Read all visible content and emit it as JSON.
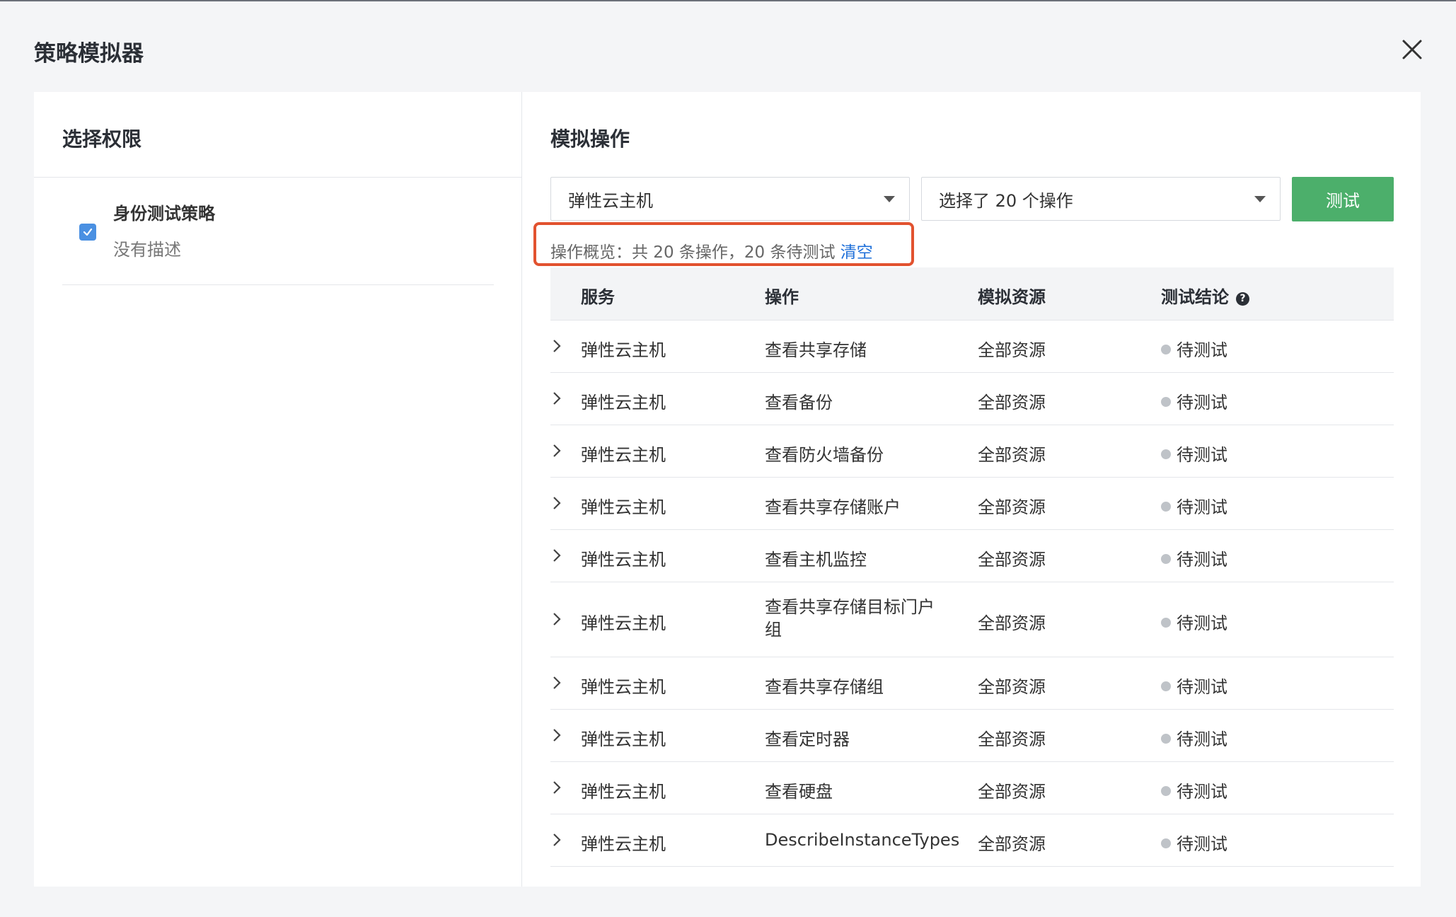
{
  "dialog": {
    "title": "策略模拟器"
  },
  "left_panel": {
    "title": "选择权限",
    "policy": {
      "name": "身份测试策略",
      "description": "没有描述",
      "checked": true
    }
  },
  "right_panel": {
    "title": "模拟操作",
    "service_select": {
      "value": "弹性云主机"
    },
    "action_select": {
      "value": "选择了 20 个操作"
    },
    "test_button": "测试",
    "summary": {
      "text": "操作概览：共 20 条操作，20 条待测试",
      "clear_link": "清空"
    },
    "table": {
      "headers": [
        "服务",
        "操作",
        "模拟资源",
        "测试结论"
      ],
      "rows": [
        {
          "service": "弹性云主机",
          "action": "查看共享存储",
          "resource": "全部资源",
          "status": "待测试"
        },
        {
          "service": "弹性云主机",
          "action": "查看备份",
          "resource": "全部资源",
          "status": "待测试"
        },
        {
          "service": "弹性云主机",
          "action": "查看防火墙备份",
          "resource": "全部资源",
          "status": "待测试"
        },
        {
          "service": "弹性云主机",
          "action": "查看共享存储账户",
          "resource": "全部资源",
          "status": "待测试"
        },
        {
          "service": "弹性云主机",
          "action": "查看主机监控",
          "resource": "全部资源",
          "status": "待测试"
        },
        {
          "service": "弹性云主机",
          "action_line1": "查看共享存储目标门户",
          "action_line2": "组",
          "resource": "全部资源",
          "status": "待测试"
        },
        {
          "service": "弹性云主机",
          "action": "查看共享存储组",
          "resource": "全部资源",
          "status": "待测试"
        },
        {
          "service": "弹性云主机",
          "action": "查看定时器",
          "resource": "全部资源",
          "status": "待测试"
        },
        {
          "service": "弹性云主机",
          "action": "查看硬盘",
          "resource": "全部资源",
          "status": "待测试"
        },
        {
          "service": "弹性云主机",
          "action": "DescribeInstanceTypes",
          "resource": "全部资源",
          "status": "待测试"
        }
      ]
    }
  },
  "colors": {
    "accent_green": "#4caf6b",
    "link_blue": "#1e6fd9",
    "highlight_red": "#e2522f",
    "checkbox_blue": "#4a90e2"
  }
}
